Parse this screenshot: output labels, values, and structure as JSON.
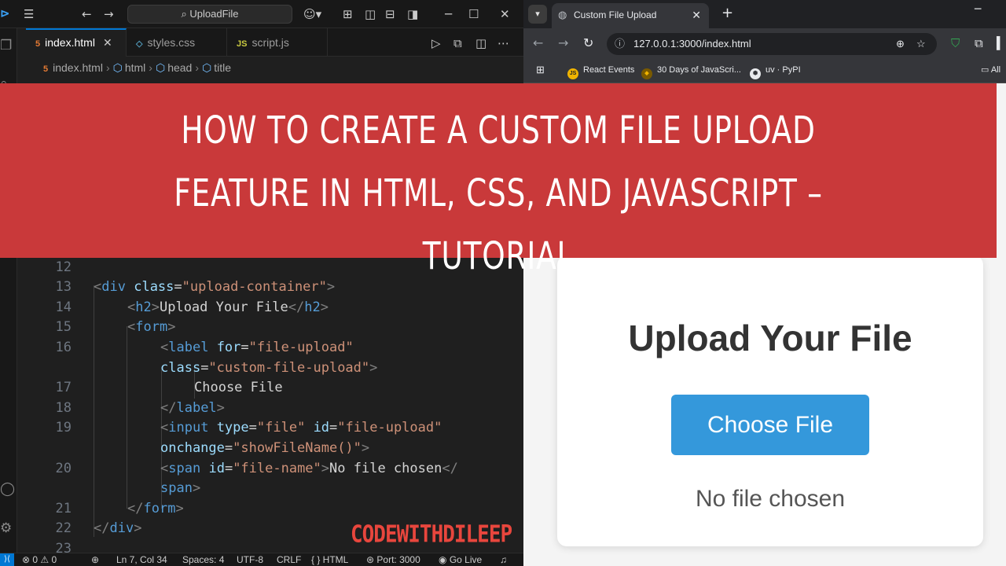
{
  "vscode": {
    "search_box": "UploadFile",
    "tabs": [
      {
        "label": "index.html",
        "type_glyph": "5",
        "type_color": "#e37933"
      },
      {
        "label": "styles.css",
        "type_glyph": "◇",
        "type_color": "#519aba"
      },
      {
        "label": "script.js",
        "type_glyph": "JS",
        "type_color": "#cbcb41"
      }
    ],
    "tab_close": "✕",
    "breadcrumb": [
      "index.html",
      "html",
      "head",
      "title"
    ],
    "code_lines": [
      {
        "n": "12"
      },
      {
        "n": "13"
      },
      {
        "n": "14"
      },
      {
        "n": "15"
      },
      {
        "n": "16"
      },
      {
        "n": ""
      },
      {
        "n": "17"
      },
      {
        "n": "18"
      },
      {
        "n": "19"
      },
      {
        "n": ""
      },
      {
        "n": "20"
      },
      {
        "n": ""
      },
      {
        "n": "21"
      },
      {
        "n": "22"
      },
      {
        "n": "23"
      }
    ],
    "code": {
      "l13_tag": "div",
      "l13_attr": "class",
      "l13_val": "\"upload-container\"",
      "l14_tag": "h2",
      "l14_text": "Upload Your File",
      "l15_tag": "form",
      "l16_tag": "label",
      "l16_attr": "for",
      "l16_val": "\"file-upload\"",
      "l16b_attr": "class",
      "l16b_val": "\"custom-file-upload\"",
      "l17_text": "Choose File",
      "l18_tag": "label",
      "l19_tag": "input",
      "l19_attr1": "type",
      "l19_val1": "\"file\"",
      "l19_attr2": "id",
      "l19_val2": "\"file-upload\"",
      "l19b_attr": "onchange",
      "l19b_val": "\"showFileName()\"",
      "l20_tag": "span",
      "l20_attr": "id",
      "l20_val": "\"file-name\"",
      "l20_text": "No file chosen",
      "l20b_tag": "span",
      "l21_tag": "form",
      "l22_tag": "div"
    },
    "watermark": "CODEWITHDILEEP",
    "status": {
      "problems": "⊗ 0 ⚠ 0",
      "position": "Ln 7, Col 34",
      "spaces": "Spaces: 4",
      "encoding": "UTF-8",
      "eol": "CRLF",
      "language": "{ } HTML",
      "port": "Port: 3000",
      "golive": "Go Live"
    }
  },
  "browser": {
    "tab_title": "Custom File Upload",
    "url": "127.0.0.1:3000/index.html",
    "bookmarks": [
      "React Events",
      "30 Days of JavaScri...",
      "uv · PyPI",
      "All"
    ],
    "page": {
      "heading": "Upload Your File",
      "button": "Choose File",
      "file_name": "No file chosen"
    },
    "colors": {
      "button": "#3498db",
      "heading": "#333333"
    }
  },
  "banner": {
    "title": "How to Create a Custom File Upload Feature in HTML, CSS, and JavaScript – Tutorial",
    "color": "#c9393a"
  }
}
